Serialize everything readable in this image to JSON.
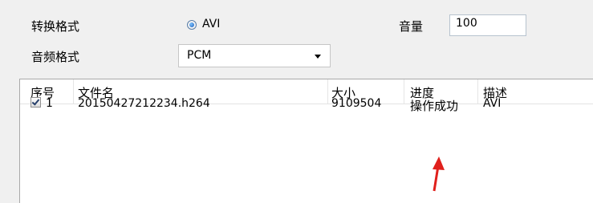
{
  "settings": {
    "convert_format_label": "转换格式",
    "convert_format_option": "AVI",
    "audio_format_label": "音频格式",
    "audio_format_value": "PCM",
    "volume_label": "音量",
    "volume_value": "100"
  },
  "file_list": {
    "columns": [
      "序号",
      "文件名",
      "大小",
      "进度",
      "描述"
    ],
    "rows": [
      {
        "checked": true,
        "index": "1",
        "filename": "20150427212234.h264",
        "size": "9109504",
        "progress": "操作成功",
        "description": "AVI"
      }
    ]
  },
  "annotation": {
    "arrow_color": "#e0201c"
  },
  "icons": [
    "radio-selected-icon",
    "dropdown-arrow-icon",
    "checkbox-checked-icon",
    "red-arrow-annotation"
  ]
}
